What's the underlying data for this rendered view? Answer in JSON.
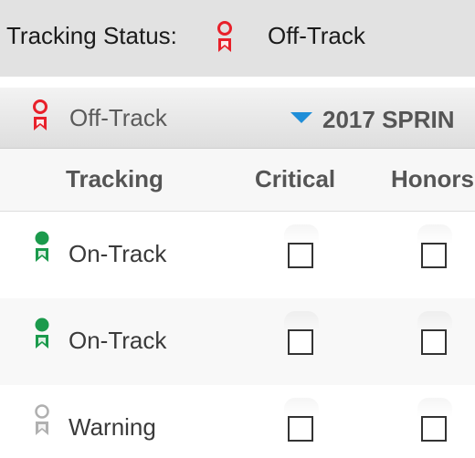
{
  "header": {
    "label": "Tracking Status:",
    "status_icon": "ribbon-award-icon",
    "status_value": "Off-Track",
    "status_color": "#e8202a"
  },
  "section": {
    "status_icon": "ribbon-award-icon",
    "status_label": "Off-Track",
    "status_color": "#e8202a",
    "term_toggle_icon": "triangle-down-icon",
    "term_label": "2017 SPRIN",
    "toggle_color": "#1f8ed8"
  },
  "columns": {
    "tracking": "Tracking",
    "critical": "Critical",
    "honors": "Honors"
  },
  "rows": [
    {
      "status": "On-Track",
      "status_color": "#1b9a4c",
      "critical_checked": false,
      "honors_checked": false
    },
    {
      "status": "On-Track",
      "status_color": "#1b9a4c",
      "critical_checked": false,
      "honors_checked": false
    },
    {
      "status": "Warning",
      "status_color": "#b0b0b0",
      "critical_checked": false,
      "honors_checked": false
    }
  ]
}
